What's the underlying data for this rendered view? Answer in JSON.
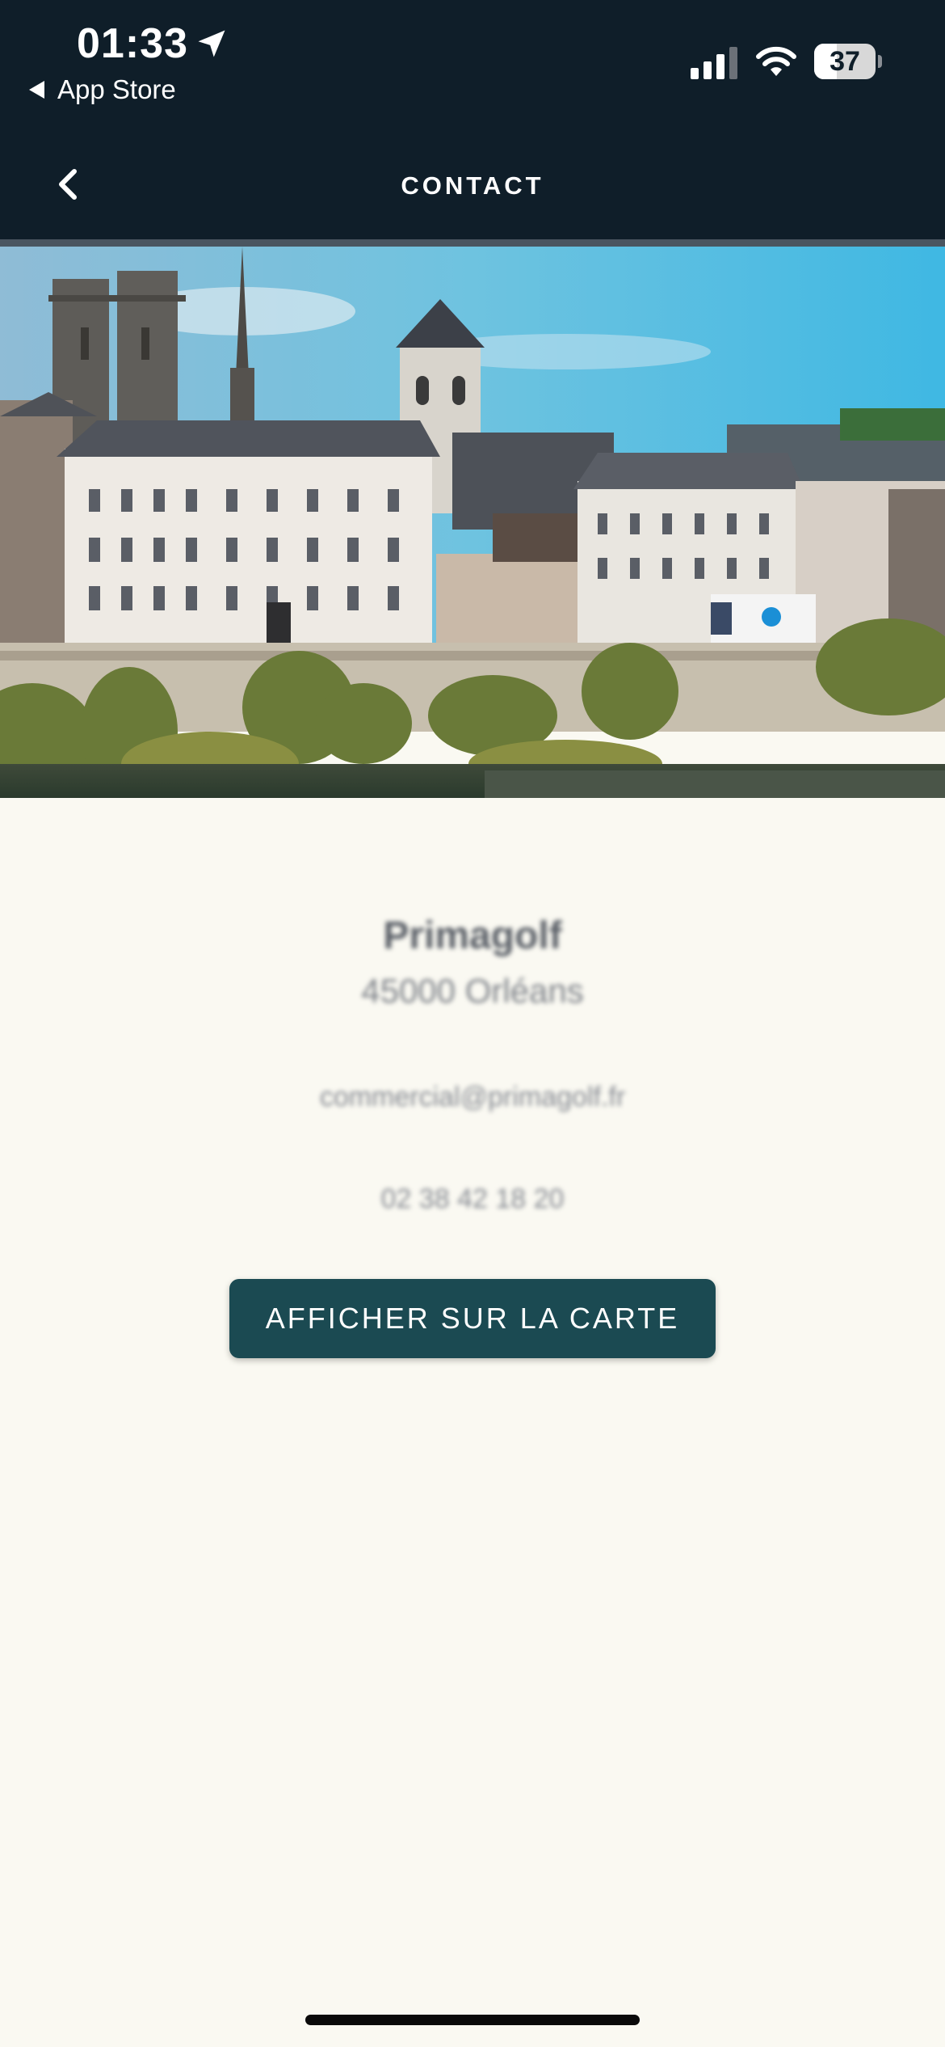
{
  "status_bar": {
    "time": "01:33",
    "back_app_label": "App Store",
    "battery_level": "37",
    "battery_fraction": 0.37
  },
  "nav": {
    "title": "CONTACT",
    "back_icon": "chevron-left-icon"
  },
  "hero": {
    "icon": "city-riverside-photo"
  },
  "contact": {
    "company": "Primagolf",
    "city": "45000 Orléans",
    "email": "commercial@primagolf.fr",
    "phone": "02 38 42 18 20"
  },
  "actions": {
    "map_button_label": "AFFICHER SUR LA CARTE"
  },
  "colors": {
    "header_bg": "#0f1e29",
    "page_bg": "#faf9f2",
    "button_bg": "#1b4a52"
  }
}
